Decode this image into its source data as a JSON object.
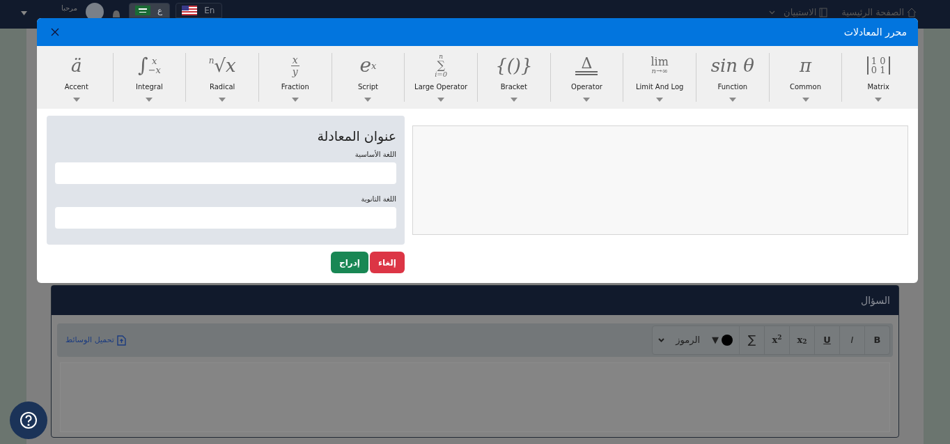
{
  "navbar": {
    "links": [
      {
        "label": "الصفحة الرئيسية",
        "dropdown": false
      },
      {
        "label": "الاستبيان",
        "dropdown": true
      }
    ],
    "greeting": "مرحبا",
    "languages": [
      {
        "label": "En",
        "selected": false
      },
      {
        "label": "ع",
        "selected": true
      }
    ]
  },
  "question_card": {
    "title": "السؤال",
    "toolbar": [
      {
        "kind": "bold",
        "label": "B"
      },
      {
        "kind": "italic",
        "label": "I"
      },
      {
        "kind": "underline",
        "label": "U"
      },
      {
        "kind": "sub",
        "label": "x",
        "script": "2"
      },
      {
        "kind": "sup",
        "label": "x",
        "script": "2"
      },
      {
        "kind": "plain",
        "label": "∑"
      },
      {
        "kind": "color",
        "label": "▼",
        "color": "#000000"
      },
      {
        "kind": "select",
        "label": "الرموز"
      }
    ],
    "upload_link": "تحميل الوسائط"
  },
  "dialog": {
    "title": "محرر المعادلات",
    "tools": [
      {
        "label": "Matrix",
        "symbol": {
          "kind": "matrix",
          "rows": [
            "1 0",
            "0 1"
          ]
        }
      },
      {
        "label": "Common",
        "symbol": {
          "kind": "plain",
          "base": "π"
        }
      },
      {
        "label": "Function",
        "symbol": {
          "kind": "plain",
          "base": "sin θ"
        }
      },
      {
        "label": "Limit And Log",
        "symbol": {
          "kind": "stack",
          "middle": "lim",
          "bottom": "n→∞"
        }
      },
      {
        "label": "Operator",
        "symbol": {
          "kind": "underlined",
          "base": "Δ"
        }
      },
      {
        "label": "Bracket",
        "symbol": {
          "kind": "plain",
          "base": "{()}"
        }
      },
      {
        "label": "Large Operator",
        "symbol": {
          "kind": "stack",
          "top": "n",
          "middle": "∑",
          "bottom": "i=0"
        }
      },
      {
        "label": "Script",
        "symbol": {
          "kind": "script",
          "base": "e",
          "sup": "x"
        }
      },
      {
        "label": "Fraction",
        "symbol": {
          "kind": "fraction",
          "top": "x",
          "bottom": "y"
        }
      },
      {
        "label": "Radical",
        "symbol": {
          "kind": "prescript",
          "pre": "n",
          "base": "√x"
        }
      },
      {
        "label": "Integral",
        "symbol": {
          "kind": "script",
          "base": "∫",
          "sup": "x",
          "sub": "−x"
        }
      },
      {
        "label": "Accent",
        "symbol": {
          "kind": "plain",
          "base": "ä"
        }
      }
    ],
    "form": {
      "heading": "عنوان المعادلة",
      "fields": [
        {
          "label": "اللغة الأساسية"
        },
        {
          "label": "اللغة الثانوية"
        }
      ]
    },
    "buttons": [
      {
        "kind": "cancel",
        "label": "إلغاء"
      },
      {
        "kind": "insert",
        "label": "إدراج"
      }
    ]
  }
}
